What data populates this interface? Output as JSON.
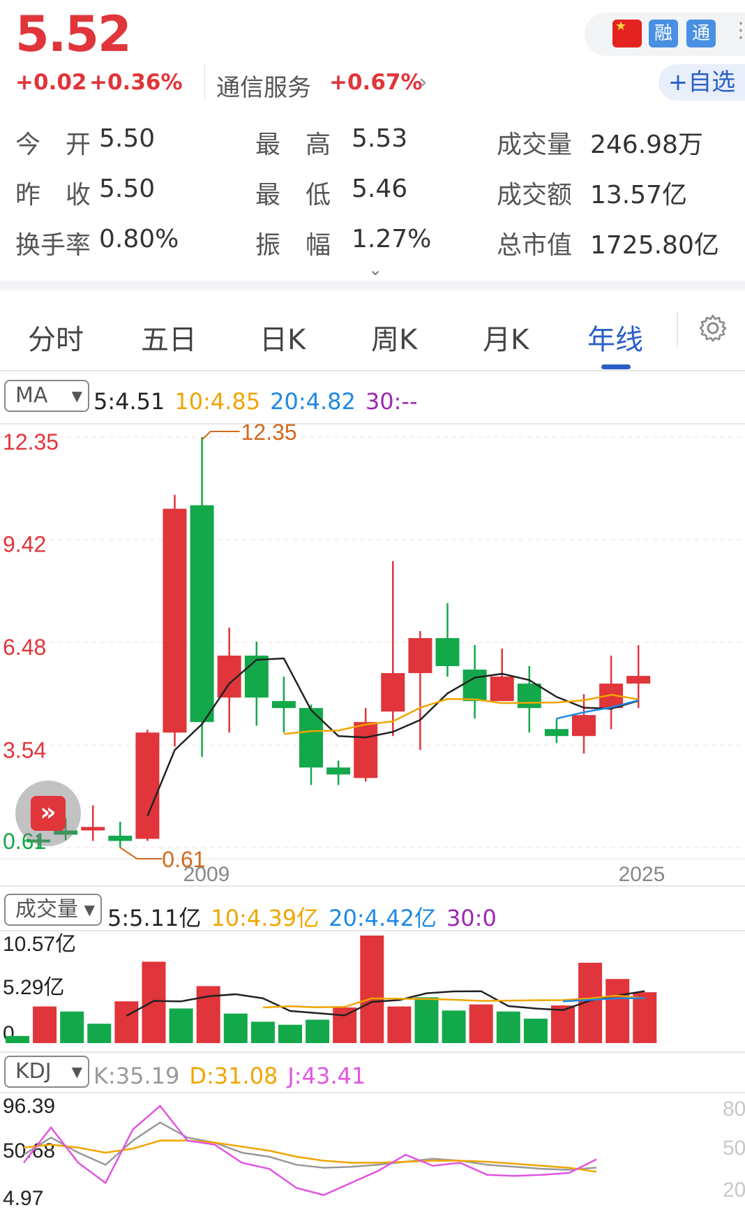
{
  "quote": {
    "price": "5.52",
    "change": "+0.02",
    "change_pct": "+0.36%",
    "sector": "通信服务",
    "sector_chg": "+0.67%",
    "add_watch": "+自选",
    "badges": [
      "融",
      "通"
    ],
    "colors": {
      "up": "#e0353a",
      "down": "#13a84a",
      "accent": "#2a5fc7"
    }
  },
  "stats": [
    {
      "label": "今　开",
      "value": "5.50"
    },
    {
      "label": "最　高",
      "value": "5.53"
    },
    {
      "label": "成交量",
      "value": "246.98万"
    },
    {
      "label": "昨　收",
      "value": "5.50"
    },
    {
      "label": "最　低",
      "value": "5.46"
    },
    {
      "label": "成交额",
      "value": "13.57亿"
    },
    {
      "label": "换手率",
      "value": "0.80%"
    },
    {
      "label": "振　幅",
      "value": "1.27%"
    },
    {
      "label": "总市值",
      "value": "1725.80亿"
    }
  ],
  "tabs": [
    "分时",
    "五日",
    "日K",
    "周K",
    "月K",
    "年线"
  ],
  "active_tab": "年线",
  "ma": {
    "selector": "MA",
    "legend": [
      {
        "text": "5:4.51",
        "color": "#222222"
      },
      {
        "text": "10:4.85",
        "color": "#f0a500"
      },
      {
        "text": "20:4.82",
        "color": "#1e88e5"
      },
      {
        "text": "30:--",
        "color": "#9c27b0"
      }
    ]
  },
  "vol": {
    "selector": "成交量",
    "legend": [
      {
        "text": "5:5.11亿",
        "color": "#222222"
      },
      {
        "text": "10:4.39亿",
        "color": "#f0a500"
      },
      {
        "text": "20:4.42亿",
        "color": "#1e88e5"
      },
      {
        "text": "30:0",
        "color": "#9c27b0"
      }
    ]
  },
  "kdj": {
    "selector": "KDJ",
    "legend": [
      {
        "text": "K:35.19",
        "color": "#999999"
      },
      {
        "text": "D:31.08",
        "color": "#f0a500"
      },
      {
        "text": "J:43.41",
        "color": "#e255e2"
      }
    ]
  },
  "chart_data": [
    {
      "type": "candlestick",
      "title": "",
      "y_ticks": [
        "12.35",
        "9.42",
        "6.48",
        "3.54",
        "0.61"
      ],
      "x_ticks": [
        "2009",
        "2025"
      ],
      "ylim": [
        0.61,
        12.35
      ],
      "max_label": "12.35",
      "min_label": "0.61",
      "candles": [
        {
          "o": 0.84,
          "h": 0.95,
          "l": 0.61,
          "c": 0.78
        },
        {
          "o": 1.1,
          "h": 1.45,
          "l": 0.82,
          "c": 0.98
        },
        {
          "o": 1.1,
          "h": 1.82,
          "l": 0.8,
          "c": 1.2
        },
        {
          "o": 0.95,
          "h": 1.35,
          "l": 0.61,
          "c": 0.8
        },
        {
          "o": 0.86,
          "h": 3.98,
          "l": 0.8,
          "c": 3.9
        },
        {
          "o": 3.9,
          "h": 10.7,
          "l": 3.5,
          "c": 10.3
        },
        {
          "o": 10.4,
          "h": 12.35,
          "l": 3.2,
          "c": 4.2
        },
        {
          "o": 4.9,
          "h": 6.9,
          "l": 3.9,
          "c": 6.1
        },
        {
          "o": 6.1,
          "h": 6.5,
          "l": 4.1,
          "c": 4.9
        },
        {
          "o": 4.8,
          "h": 5.5,
          "l": 3.9,
          "c": 4.6
        },
        {
          "o": 4.6,
          "h": 4.7,
          "l": 2.4,
          "c": 2.9
        },
        {
          "o": 2.9,
          "h": 3.1,
          "l": 2.4,
          "c": 2.7
        },
        {
          "o": 2.6,
          "h": 4.6,
          "l": 2.5,
          "c": 4.2
        },
        {
          "o": 4.5,
          "h": 8.8,
          "l": 3.8,
          "c": 5.6
        },
        {
          "o": 5.6,
          "h": 6.8,
          "l": 3.4,
          "c": 6.6
        },
        {
          "o": 6.6,
          "h": 7.6,
          "l": 5.5,
          "c": 5.8
        },
        {
          "o": 5.7,
          "h": 6.4,
          "l": 4.3,
          "c": 4.8
        },
        {
          "o": 4.8,
          "h": 6.3,
          "l": 4.8,
          "c": 5.5
        },
        {
          "o": 5.3,
          "h": 5.8,
          "l": 3.9,
          "c": 4.6
        },
        {
          "o": 4.0,
          "h": 4.3,
          "l": 3.6,
          "c": 3.8
        },
        {
          "o": 3.8,
          "h": 5.0,
          "l": 3.3,
          "c": 4.4
        },
        {
          "o": 4.6,
          "h": 6.1,
          "l": 4.0,
          "c": 5.3
        },
        {
          "o": 5.3,
          "h": 6.4,
          "l": 4.6,
          "c": 5.52
        }
      ],
      "ma5": [
        null,
        null,
        null,
        null,
        1.51,
        3.4,
        4.14,
        5.3,
        5.98,
        6.02,
        4.54,
        3.8,
        3.76,
        3.92,
        4.26,
        5.02,
        5.47,
        5.58,
        5.4,
        4.92,
        4.61,
        4.58,
        4.81
      ],
      "ma10": [
        null,
        null,
        null,
        null,
        null,
        null,
        null,
        null,
        null,
        3.86,
        3.94,
        3.96,
        4.13,
        4.22,
        4.61,
        4.86,
        4.85,
        4.74,
        4.75,
        4.76,
        4.82,
        4.98,
        4.85
      ],
      "ma20": [
        null,
        null,
        null,
        null,
        null,
        null,
        null,
        null,
        null,
        null,
        null,
        null,
        null,
        null,
        null,
        null,
        null,
        null,
        null,
        4.3,
        4.48,
        4.62,
        4.82
      ]
    },
    {
      "type": "bar",
      "title": "",
      "y_ticks": [
        "10.57亿",
        "5.29亿",
        "0"
      ],
      "ylim": [
        0,
        10.57
      ],
      "values": [
        0.7,
        3.6,
        3.1,
        1.9,
        4.1,
        8.0,
        3.4,
        5.6,
        2.9,
        2.1,
        1.8,
        2.3,
        3.5,
        10.57,
        3.6,
        4.5,
        3.2,
        3.8,
        3.1,
        2.4,
        3.7,
        7.9,
        6.3,
        5.0
      ],
      "up": [
        false,
        true,
        false,
        false,
        true,
        true,
        false,
        true,
        false,
        false,
        false,
        false,
        true,
        true,
        true,
        false,
        false,
        true,
        false,
        false,
        true,
        true,
        true,
        true
      ],
      "ma5": [
        null,
        null,
        null,
        null,
        2.68,
        4.14,
        4.1,
        4.6,
        4.8,
        4.4,
        3.16,
        2.94,
        2.72,
        4.05,
        4.23,
        4.9,
        5.08,
        5.1,
        3.64,
        3.4,
        3.24,
        4.18,
        4.68,
        5.11
      ],
      "ma10": [
        null,
        null,
        null,
        null,
        null,
        null,
        null,
        null,
        null,
        3.5,
        3.62,
        3.52,
        3.56,
        4.4,
        4.36,
        4.33,
        4.26,
        4.14,
        4.18,
        4.21,
        4.22,
        4.4,
        4.67,
        4.39
      ],
      "ma20": [
        null,
        null,
        null,
        null,
        null,
        null,
        null,
        null,
        null,
        null,
        null,
        null,
        null,
        null,
        null,
        null,
        null,
        null,
        null,
        null,
        4.1,
        4.25,
        4.4,
        4.42
      ]
    },
    {
      "type": "line",
      "title": "",
      "y_ticks": [
        "96.39",
        "50.68",
        "4.97"
      ],
      "right_ticks": [
        "80",
        "50",
        "20"
      ],
      "ylim": [
        4.97,
        96.39
      ],
      "series": [
        {
          "name": "K",
          "color": "#999999",
          "values": [
            48,
            65,
            50,
            38,
            62,
            80,
            65,
            60,
            50,
            46,
            38,
            35,
            36,
            38,
            41,
            44,
            42,
            38,
            36,
            34,
            33,
            35.19
          ]
        },
        {
          "name": "D",
          "color": "#f0a500",
          "values": [
            55,
            58,
            55,
            50,
            54,
            62,
            62,
            60,
            56,
            52,
            46,
            42,
            40,
            40,
            41,
            42,
            42,
            41,
            39,
            37,
            35,
            31.08
          ]
        },
        {
          "name": "J",
          "color": "#e255e2",
          "values": [
            40,
            75,
            40,
            20,
            73,
            96.39,
            62,
            58,
            40,
            34,
            15,
            8,
            20,
            32,
            48,
            37,
            40,
            28,
            27,
            28,
            30,
            43.41
          ]
        }
      ]
    }
  ]
}
